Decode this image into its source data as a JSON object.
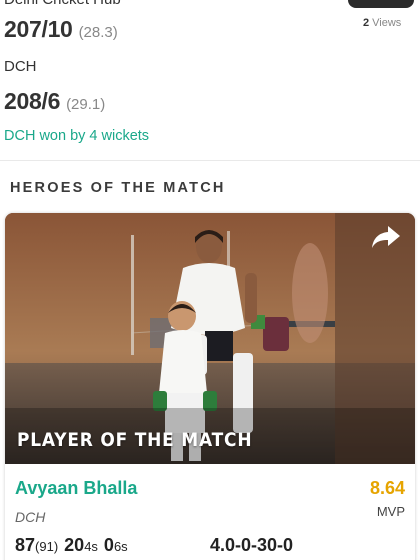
{
  "match": {
    "team1_name_partial": "Delhi Cricket Hub",
    "team1_runs": "207/10",
    "team1_overs": "(28.3)",
    "team2_name": "DCH",
    "team2_runs": "208/6",
    "team2_overs": "(29.1)",
    "result": "DCH won by 4 wickets",
    "views_count": "2",
    "views_label": "Views"
  },
  "heroes": {
    "section_title": "HEROES OF THE MATCH",
    "card": {
      "photo_label": "PLAYER OF THE MATCH",
      "player_name": "Avyaan Bhalla",
      "player_team": "DCH",
      "rating_value": "8.64",
      "rating_label": "MVP",
      "batting": {
        "runs": "87",
        "balls": "(91)",
        "fours": "20",
        "fours_suffix": "4s",
        "sixes": "0",
        "sixes_suffix": "6s"
      },
      "bowling": "4.0-0-30-0"
    }
  },
  "colors": {
    "accent_green": "#1aa88a",
    "mvp_gold": "#e6a400",
    "muted_gray": "#888888"
  },
  "icons": [
    "share-icon"
  ]
}
